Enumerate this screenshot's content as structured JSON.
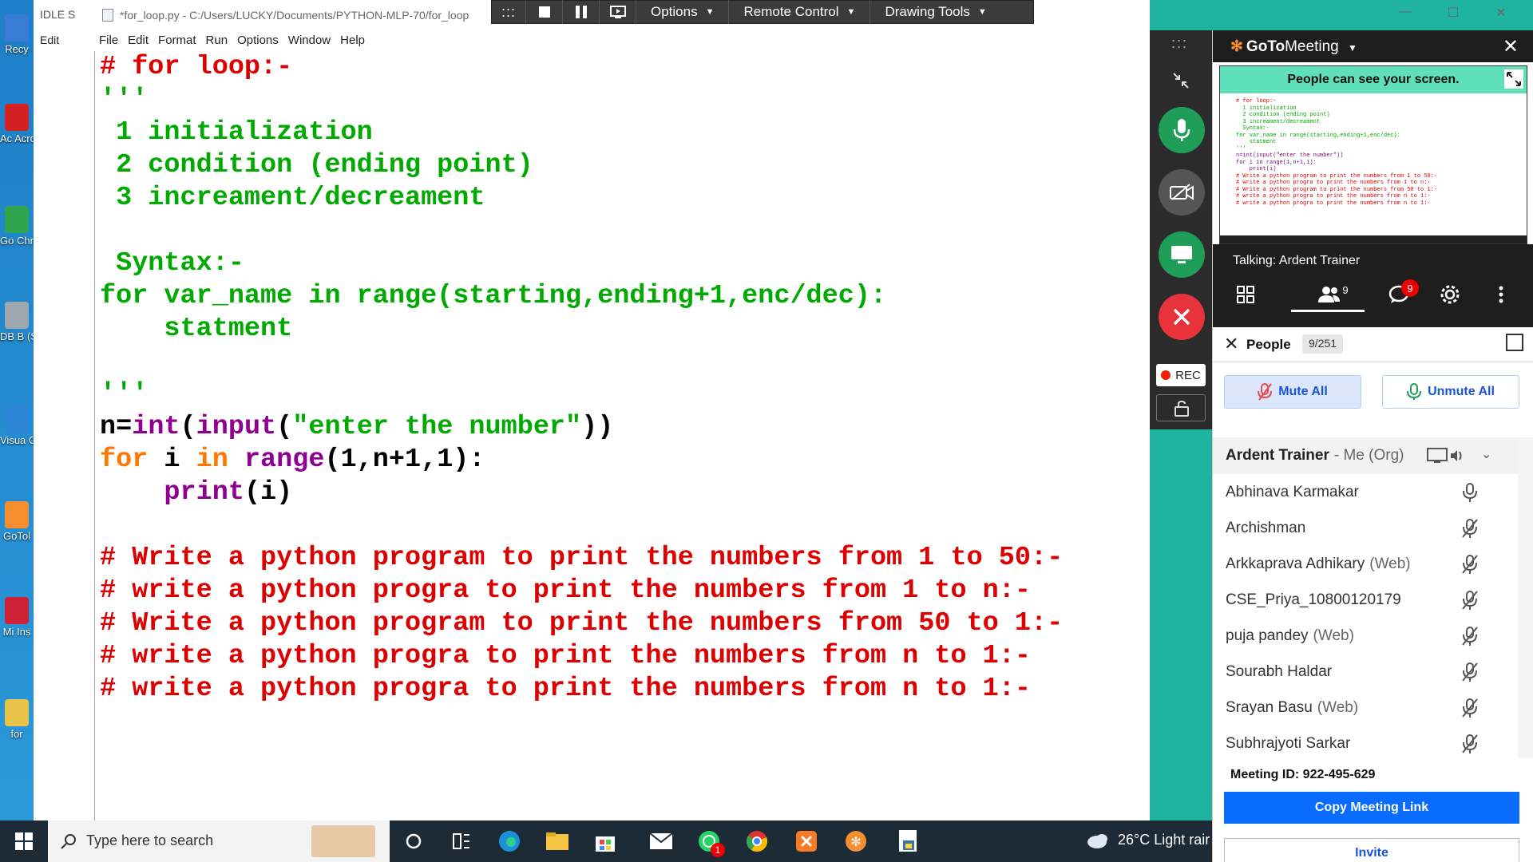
{
  "desktop": {
    "icons": [
      {
        "label": "Recy",
        "color": "#3a7bd5"
      },
      {
        "label": "Ac Acro",
        "color": "#d32020"
      },
      {
        "label": "Go Chr",
        "color": "#2ea44f"
      },
      {
        "label": "DB B (SC",
        "color": "#9ea7ad"
      },
      {
        "label": "Visua Co",
        "color": "#2c86d8"
      },
      {
        "label": "GoTol",
        "color": "#f68d2e"
      },
      {
        "label": "Mi Ins",
        "color": "#c23"
      },
      {
        "label": "for",
        "color": "#e8c34a"
      }
    ]
  },
  "idle_back": {
    "title": "IDLE S",
    "menu": "Edit"
  },
  "editor": {
    "title": "*for_loop.py - C:/Users/LUCKY/Documents/PYTHON-MLP-70/for_loop",
    "menu": [
      "File",
      "Edit",
      "Format",
      "Run",
      "Options",
      "Window",
      "Help"
    ],
    "code_lines": [
      [
        {
          "t": "# for loop:-",
          "c": "comment"
        }
      ],
      [
        {
          "t": "'''",
          "c": "string"
        }
      ],
      [
        {
          "t": " 1 initialization",
          "c": "string"
        }
      ],
      [
        {
          "t": " 2 condition (ending point)",
          "c": "string"
        }
      ],
      [
        {
          "t": " 3 increament/decreament",
          "c": "string"
        }
      ],
      [
        {
          "t": "",
          "c": "string"
        }
      ],
      [
        {
          "t": " Syntax:-",
          "c": "string"
        }
      ],
      [
        {
          "t": "for var_name in range(starting,ending+1,enc/dec):",
          "c": "string"
        }
      ],
      [
        {
          "t": "    statment",
          "c": "string"
        }
      ],
      [
        {
          "t": "",
          "c": "string"
        }
      ],
      [
        {
          "t": "'''",
          "c": "string"
        }
      ],
      [
        {
          "t": "n=",
          "c": "plain"
        },
        {
          "t": "int",
          "c": "builtin"
        },
        {
          "t": "(",
          "c": "plain"
        },
        {
          "t": "input",
          "c": "builtin"
        },
        {
          "t": "(",
          "c": "plain"
        },
        {
          "t": "\"enter the number\"",
          "c": "string"
        },
        {
          "t": "))",
          "c": "plain"
        }
      ],
      [
        {
          "t": "for",
          "c": "keyword"
        },
        {
          "t": " i ",
          "c": "plain"
        },
        {
          "t": "in",
          "c": "keyword"
        },
        {
          "t": " ",
          "c": "plain"
        },
        {
          "t": "range",
          "c": "builtin"
        },
        {
          "t": "(1,n+1,1):",
          "c": "plain"
        }
      ],
      [
        {
          "t": "    ",
          "c": "plain"
        },
        {
          "t": "print",
          "c": "builtin"
        },
        {
          "t": "(i)",
          "c": "plain"
        }
      ],
      [
        {
          "t": "",
          "c": "plain"
        }
      ],
      [
        {
          "t": "# Write a python program to print the numbers from 1 to 50:-",
          "c": "comment"
        }
      ],
      [
        {
          "t": "# write a python progra to print the numbers from 1 to n:-",
          "c": "comment"
        }
      ],
      [
        {
          "t": "# Write a python program to print the numbers from 50 to 1:-",
          "c": "comment"
        }
      ],
      [
        {
          "t": "# write a python progra to print the numbers from n to 1:-",
          "c": "comment"
        }
      ],
      [
        {
          "t": "# write a python progra to print the numbers from n to 1:-",
          "c": "comment"
        }
      ]
    ]
  },
  "sharebar": {
    "grip": ":::",
    "menus": [
      "Options",
      "Remote Control",
      "Drawing Tools"
    ]
  },
  "window_controls": {
    "minimize": "—",
    "maximize": "☐",
    "close": "✕"
  },
  "rail": {
    "rec_label": "REC"
  },
  "gotomeeting": {
    "brand_bold": "GoTo",
    "brand_light": "Meeting",
    "banner": "People can see your screen.",
    "preview_lines": [
      "# for loop:-",
      "  1 initialization",
      "  2 condition (ending point)",
      "  3 increament/decreament",
      "",
      "  Syntax:-",
      "for var_name in range(starting,ending+1,enc/dec):",
      "    statment",
      "'''",
      "n=int(input(\"enter the number\"))",
      "for i in range(1,n+1,1):",
      "    print(i)",
      "",
      "# Write a python program to print the numbers from 1 to 50:-",
      "# write a python progra to print the numbers from 1 to n:-",
      "# Write a python program to print the numbers from 50 to 1:-",
      "# write a python progra to print the numbers from n to 1:-",
      "# write a python progra to print the numbers from n to 1:-"
    ],
    "talking": "Talking: Ardent Trainer",
    "people_tab_count": "9",
    "chat_badge": "9",
    "people_label": "People",
    "people_count": "9/251",
    "mute_all": "Mute All",
    "unmute_all": "Unmute All",
    "me": {
      "name": "Ardent Trainer",
      "tag": "- Me (Org)"
    },
    "participants": [
      {
        "name": "Abhinava Karmakar",
        "web": "",
        "muted": false
      },
      {
        "name": "Archishman",
        "web": "",
        "muted": true
      },
      {
        "name": "Arkkaprava Adhikary",
        "web": "(Web)",
        "muted": true
      },
      {
        "name": "CSE_Priya_10800120179",
        "web": "",
        "muted": true
      },
      {
        "name": "puja pandey",
        "web": "(Web)",
        "muted": true
      },
      {
        "name": "Sourabh Haldar",
        "web": "",
        "muted": true
      },
      {
        "name": "Srayan Basu",
        "web": "(Web)",
        "muted": true
      },
      {
        "name": "Subhrajyoti Sarkar",
        "web": "",
        "muted": true
      }
    ],
    "meeting_id_label": "Meeting ID:",
    "meeting_id": "922-495-629",
    "copy_link": "Copy Meeting Link",
    "invite": "Invite"
  },
  "taskbar": {
    "search_placeholder": "Type here to search",
    "whatsapp_badge": "1",
    "weather": "26°C  Light rair"
  },
  "colors": {
    "comment": "#dd0000",
    "string": "#00aa00",
    "keyword": "#ff7700",
    "builtin": "#900090",
    "accent_blue": "#0a6cff",
    "goto_orange": "#f68d2e"
  }
}
